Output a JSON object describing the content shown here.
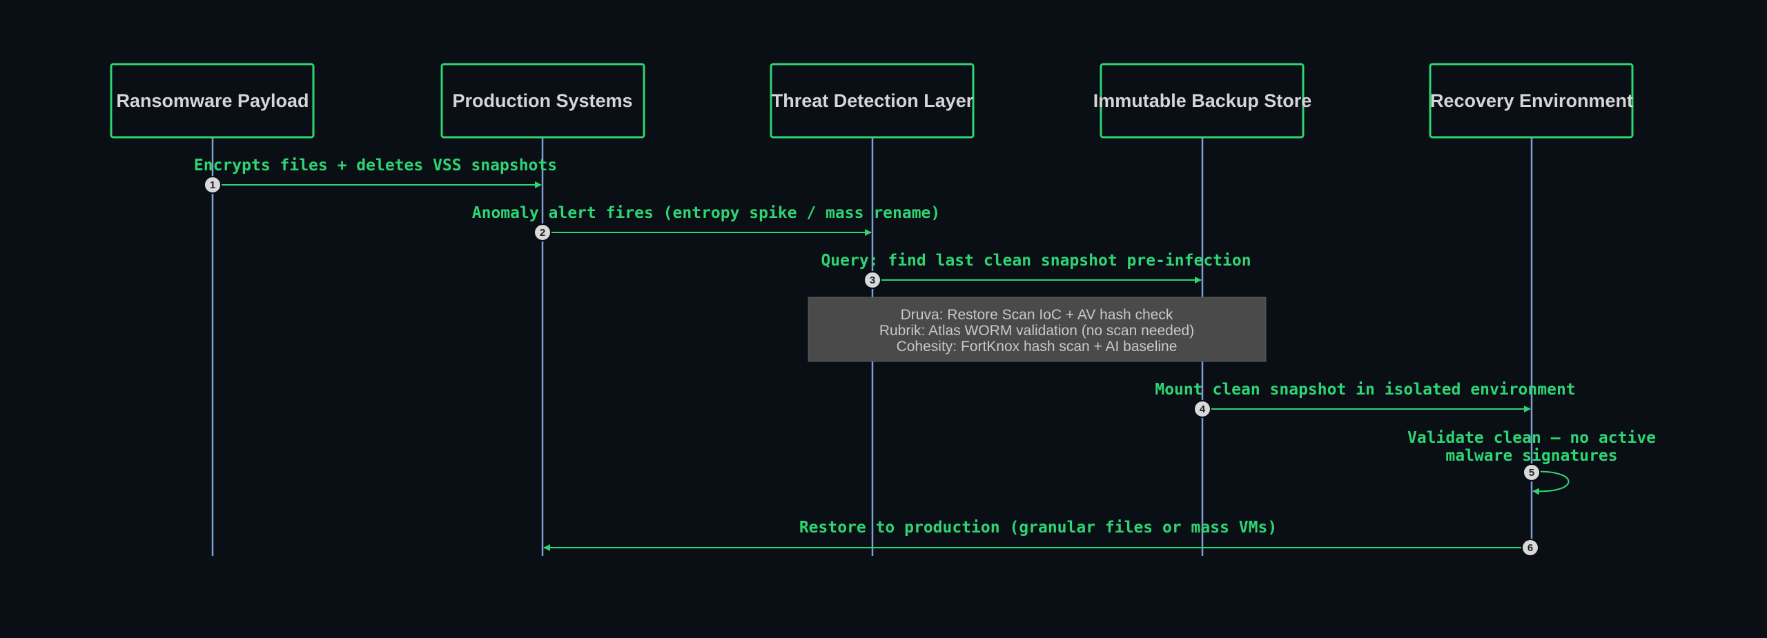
{
  "actors": [
    {
      "id": "payload",
      "label": "Ransomware Payload"
    },
    {
      "id": "prod",
      "label": "Production Systems"
    },
    {
      "id": "detect",
      "label": "Threat Detection Layer"
    },
    {
      "id": "backup",
      "label": "Immutable Backup Store"
    },
    {
      "id": "recovery",
      "label": "Recovery Environment"
    }
  ],
  "messages": [
    {
      "seq": "1",
      "from": "payload",
      "to": "prod",
      "label": "Encrypts files + deletes VSS snapshots"
    },
    {
      "seq": "2",
      "from": "prod",
      "to": "detect",
      "label": "Anomaly alert fires (entropy spike / mass rename)"
    },
    {
      "seq": "3",
      "from": "detect",
      "to": "backup",
      "label": "Query: find last clean snapshot pre-infection"
    },
    {
      "seq": "4",
      "from": "backup",
      "to": "recovery",
      "label": "Mount clean snapshot in isolated environment"
    },
    {
      "seq": "5",
      "from": "recovery",
      "to": "recovery",
      "label_lines": [
        "Validate clean — no active",
        "malware signatures"
      ]
    },
    {
      "seq": "6",
      "from": "recovery",
      "to": "prod",
      "label": "Restore to production (granular files or mass VMs)"
    }
  ],
  "note": {
    "over": [
      "detect",
      "backup"
    ],
    "lines": [
      "Druva: Restore Scan IoC + AV hash check",
      "Rubrik: Atlas WORM validation (no scan needed)",
      "Cohesity: FortKnox hash scan + AI baseline"
    ]
  },
  "colors": {
    "background": "#0a0e15",
    "accent": "#2ed573",
    "lifeline": "#7c9fd4",
    "note_fill": "#4a4a4a"
  }
}
